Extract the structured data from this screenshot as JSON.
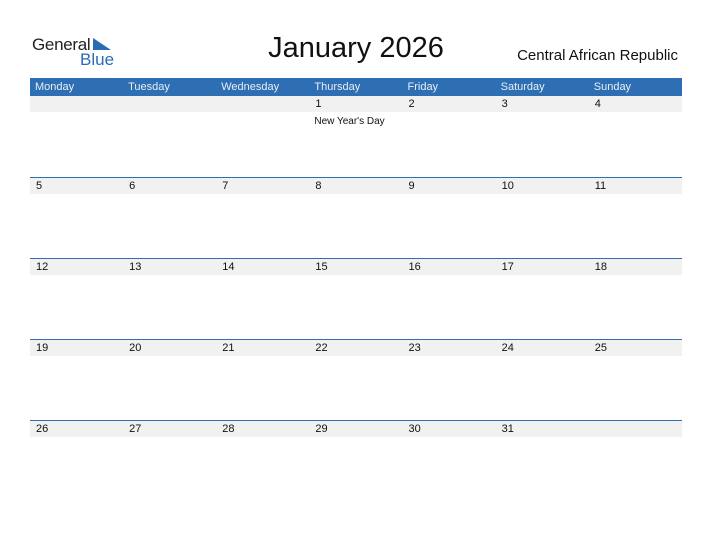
{
  "logo": {
    "general": "General",
    "blue": "Blue"
  },
  "title": "January 2026",
  "country": "Central African Republic",
  "weekdays": [
    "Monday",
    "Tuesday",
    "Wednesday",
    "Thursday",
    "Friday",
    "Saturday",
    "Sunday"
  ],
  "weeks": [
    [
      {
        "day": ""
      },
      {
        "day": ""
      },
      {
        "day": ""
      },
      {
        "day": "1",
        "event": "New Year's Day"
      },
      {
        "day": "2"
      },
      {
        "day": "3"
      },
      {
        "day": "4"
      }
    ],
    [
      {
        "day": "5"
      },
      {
        "day": "6"
      },
      {
        "day": "7"
      },
      {
        "day": "8"
      },
      {
        "day": "9"
      },
      {
        "day": "10"
      },
      {
        "day": "11"
      }
    ],
    [
      {
        "day": "12"
      },
      {
        "day": "13"
      },
      {
        "day": "14"
      },
      {
        "day": "15"
      },
      {
        "day": "16"
      },
      {
        "day": "17"
      },
      {
        "day": "18"
      }
    ],
    [
      {
        "day": "19"
      },
      {
        "day": "20"
      },
      {
        "day": "21"
      },
      {
        "day": "22"
      },
      {
        "day": "23"
      },
      {
        "day": "24"
      },
      {
        "day": "25"
      }
    ],
    [
      {
        "day": "26"
      },
      {
        "day": "27"
      },
      {
        "day": "28"
      },
      {
        "day": "29"
      },
      {
        "day": "30"
      },
      {
        "day": "31"
      },
      {
        "day": ""
      }
    ]
  ],
  "colors": {
    "accent": "#2e6fb3",
    "strip": "#f1f1f1"
  }
}
